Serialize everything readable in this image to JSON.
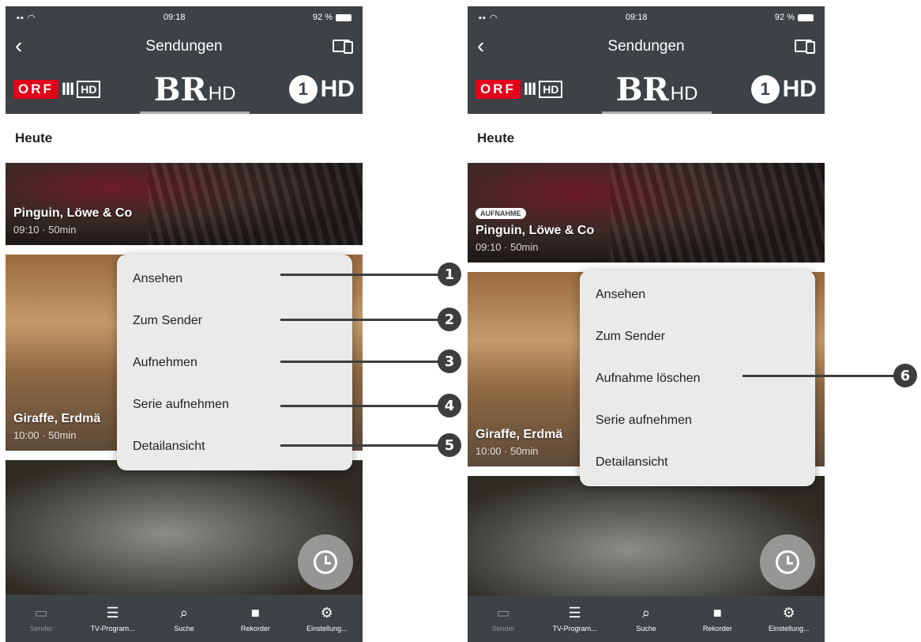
{
  "status": {
    "time": "09:18",
    "battery": "92 %"
  },
  "nav": {
    "title": "Sendungen"
  },
  "channels": [
    {
      "name": "ORF III HD",
      "orf": "ORF",
      "bars": "III",
      "hd": "HD"
    },
    {
      "name": "BR HD",
      "logo": "BR",
      "suffix": "HD"
    },
    {
      "name": "ONE HD",
      "logo": "1",
      "suffix": "HD"
    }
  ],
  "day": "Heute",
  "programs": [
    {
      "title": "Pinguin, Löwe & Co",
      "meta": "09:10 · 50min"
    },
    {
      "title": "Giraffe, Erdmä",
      "meta": "10:00 · 50min"
    },
    {
      "title": "",
      "meta": ""
    }
  ],
  "right_programs": [
    {
      "badge": "AUFNAHME",
      "title": "Pinguin, Löwe & Co",
      "meta": "09:10 · 50min"
    },
    {
      "title": "Giraffe, Erdmä",
      "meta": "10:00 · 50min"
    }
  ],
  "menu_left": [
    "Ansehen",
    "Zum Sender",
    "Aufnehmen",
    "Serie aufnehmen",
    "Detailansicht"
  ],
  "menu_right": [
    "Ansehen",
    "Zum Sender",
    "Aufnahme löschen",
    "Serie aufnehmen",
    "Detailansicht"
  ],
  "tabs": [
    {
      "label": "Sender",
      "icon": "tv-icon"
    },
    {
      "label": "TV-Program...",
      "icon": "list-icon"
    },
    {
      "label": "Suche",
      "icon": "search-icon"
    },
    {
      "label": "Rekorder",
      "icon": "camera-icon"
    },
    {
      "label": "Einstellung...",
      "icon": "gear-icon"
    }
  ],
  "callouts": [
    "1",
    "2",
    "3",
    "4",
    "5",
    "6"
  ]
}
